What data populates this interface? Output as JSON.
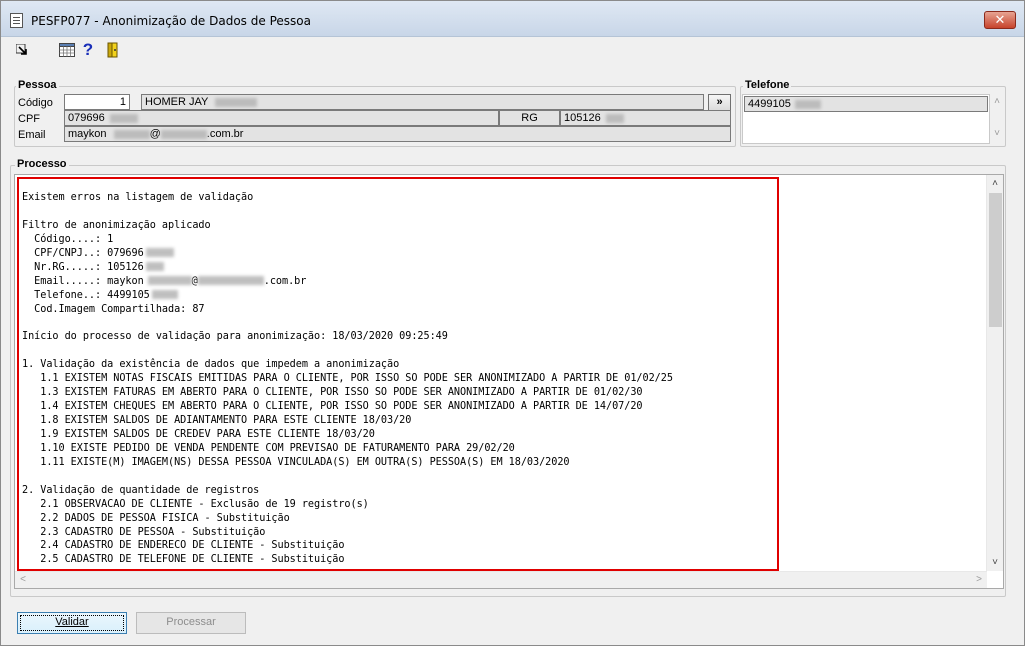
{
  "window": {
    "title": "PESFP077 - Anonimização de Dados de Pessoa",
    "close_label": "✕"
  },
  "toolbar": {
    "icons": [
      "exit-arrow-icon",
      "calendar-grid-icon",
      "help-icon",
      "door-exit-icon"
    ],
    "help_glyph": "?"
  },
  "pessoa": {
    "group_label": "Pessoa",
    "codigo_label": "Código",
    "codigo_value": "1",
    "name_value": "HOMER JAY",
    "search_btn": "»",
    "cpf_label": "CPF",
    "cpf_value": "079696",
    "rg_label": "RG",
    "rg_value": "105126",
    "email_label": "Email",
    "email_prefix": "maykon",
    "email_at": "@",
    "email_suffix": ".com.br"
  },
  "telefone": {
    "group_label": "Telefone",
    "value": "4499105"
  },
  "processo": {
    "group_label": "Processo",
    "log_lines": [
      "Existem erros na listagem de validação",
      "",
      "Filtro de anonimização aplicado",
      "  Código....: 1",
      "  CPF/CNPJ..: 079696",
      "  Nr.RG.....: 105126",
      "  Email.....: maykon",
      "  Telefone..: 4499105",
      "  Cod.Imagem Compartilhada: 87",
      "",
      "Início do processo de validação para anonimização: 18/03/2020 09:25:49",
      "",
      "1. Validação da existência de dados que impedem a anonimização",
      "   1.1 EXISTEM NOTAS FISCAIS EMITIDAS PARA O CLIENTE, POR ISSO SO PODE SER ANONIMIZADO A PARTIR DE 01/02/25",
      "   1.3 EXISTEM FATURAS EM ABERTO PARA O CLIENTE, POR ISSO SO PODE SER ANONIMIZADO A PARTIR DE 01/02/30",
      "   1.4 EXISTEM CHEQUES EM ABERTO PARA O CLIENTE, POR ISSO SO PODE SER ANONIMIZADO A PARTIR DE 14/07/20",
      "   1.8 EXISTEM SALDOS DE ADIANTAMENTO PARA ESTE CLIENTE 18/03/20",
      "   1.9 EXISTEM SALDOS DE CREDEV PARA ESTE CLIENTE 18/03/20",
      "   1.10 EXISTE PEDIDO DE VENDA PENDENTE COM PREVISAO DE FATURAMENTO PARA 29/02/20",
      "   1.11 EXISTE(M) IMAGEM(NS) DESSA PESSOA VINCULADA(S) EM OUTRA(S) PESSOA(S) EM 18/03/2020",
      "",
      "2. Validação de quantidade de registros",
      "   2.1 OBSERVACAO DE CLIENTE - Exclusão de 19 registro(s)",
      "   2.2 DADOS DE PESSOA FISICA - Substituição",
      "   2.3 CADASTRO DE PESSOA - Substituição",
      "   2.4 CADASTRO DE ENDERECO DE CLIENTE - Substituição",
      "   2.5 CADASTRO DE TELEFONE DE CLIENTE - Substituição"
    ],
    "email_line_at": "@",
    "email_line_suffix": ".com.br"
  },
  "buttons": {
    "validar": "Validar",
    "processar": "Processar"
  },
  "scroll_glyphs": {
    "up": "˄",
    "down": "˅",
    "left": "<",
    "right": ">"
  }
}
